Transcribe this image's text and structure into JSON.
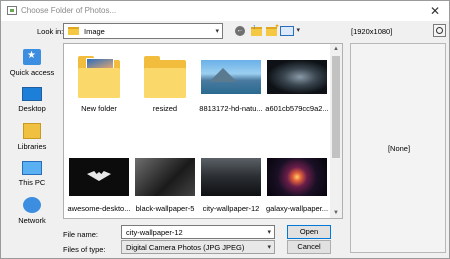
{
  "window": {
    "title": "Choose Folder of Photos..."
  },
  "toolbar": {
    "lookin_label": "Look in:",
    "lookin_value": "Image"
  },
  "places": [
    {
      "label": "Quick access",
      "icon": "quick-access-icon"
    },
    {
      "label": "Desktop",
      "icon": "desktop-icon"
    },
    {
      "label": "Libraries",
      "icon": "libraries-icon"
    },
    {
      "label": "This PC",
      "icon": "this-pc-icon"
    },
    {
      "label": "Network",
      "icon": "network-icon"
    }
  ],
  "files": [
    {
      "name": "New folder",
      "kind": "folder"
    },
    {
      "name": "resized",
      "kind": "folder"
    },
    {
      "name": "8813172-hd-natu...",
      "kind": "image"
    },
    {
      "name": "a601cb579cc9a2...",
      "kind": "image"
    },
    {
      "name": "awesome-deskto...",
      "kind": "image"
    },
    {
      "name": "black-wallpaper-5",
      "kind": "image"
    },
    {
      "name": "city-wallpaper-12",
      "kind": "image"
    },
    {
      "name": "galaxy-wallpaper...",
      "kind": "image"
    }
  ],
  "form": {
    "file_name_label": "File name:",
    "file_name_value": "city-wallpaper-12",
    "file_type_label": "Files of type:",
    "file_type_value": "Digital Camera Photos (JPG JPEG)"
  },
  "buttons": {
    "open": "Open",
    "cancel": "Cancel"
  },
  "preview": {
    "size": "[1920x1080]",
    "none": "[None]"
  },
  "colors": {
    "accent": "#0078d7",
    "folder": "#f2bd3c"
  }
}
